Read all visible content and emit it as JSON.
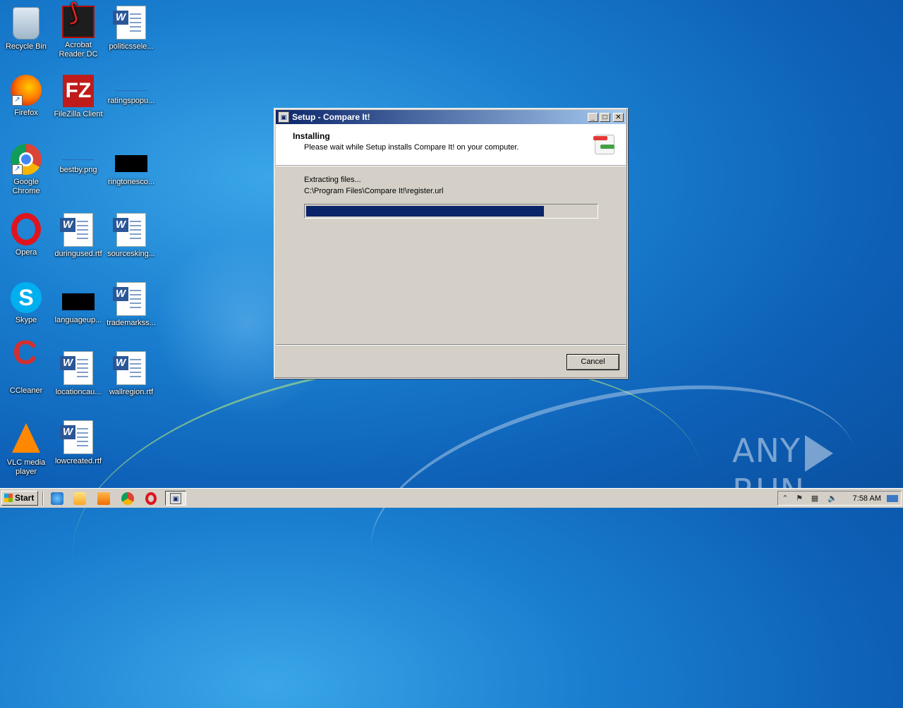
{
  "desktop": {
    "icons": [
      {
        "label": "Recycle Bin"
      },
      {
        "label": "Acrobat Reader DC"
      },
      {
        "label": "politicssele..."
      },
      {
        "label": "Firefox"
      },
      {
        "label": "FileZilla Client"
      },
      {
        "label": "ratingspopu..."
      },
      {
        "label": "Google Chrome"
      },
      {
        "label": "bestby.png"
      },
      {
        "label": "ringtonesco..."
      },
      {
        "label": "Opera"
      },
      {
        "label": "duringused.rtf"
      },
      {
        "label": "sourcesking..."
      },
      {
        "label": "Skype"
      },
      {
        "label": "languageup..."
      },
      {
        "label": "trademarkss..."
      },
      {
        "label": "CCleaner"
      },
      {
        "label": "locationcau..."
      },
      {
        "label": "wallregion.rtf"
      },
      {
        "label": "VLC media player"
      },
      {
        "label": "lowcreated.rtf"
      }
    ]
  },
  "window": {
    "title": "Setup - Compare It!",
    "header_title": "Installing",
    "header_subtitle": "Please wait while Setup installs Compare It! on your computer.",
    "status_line": "Extracting files...",
    "file_path": "C:\\Program Files\\Compare It!\\register.url",
    "progress_fraction": 0.82,
    "cancel_label": "Cancel",
    "progress_color": "#0a246a"
  },
  "taskbar": {
    "start_label": "Start",
    "clock": "7:58 AM"
  },
  "watermark": {
    "left": "ANY",
    "right": "RUN"
  }
}
